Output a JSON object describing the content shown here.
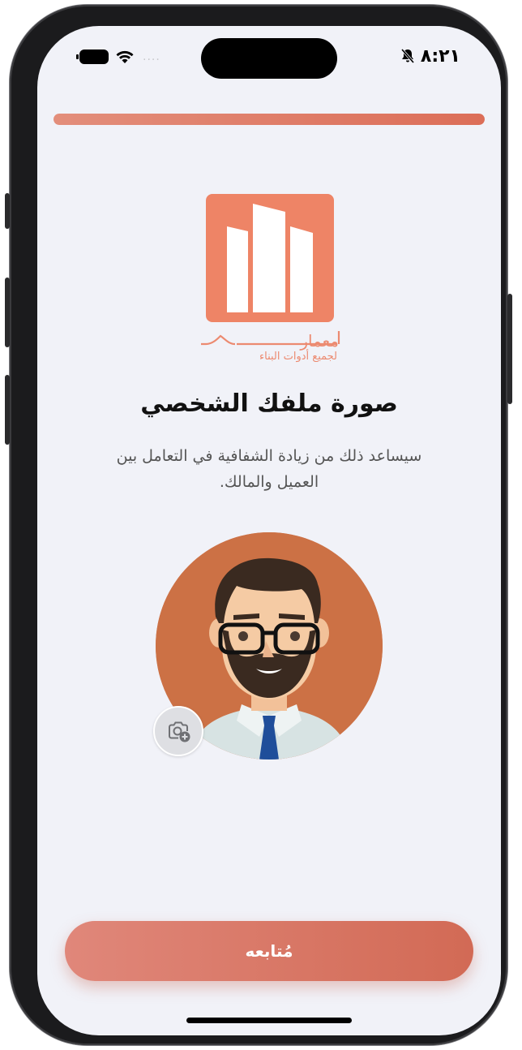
{
  "status_bar": {
    "time": "٨:٢١",
    "signal_dots": "....",
    "icons": [
      "battery-icon",
      "wifi-icon",
      "bell-slash-icon"
    ]
  },
  "onboarding": {
    "progress": 1.0,
    "progress_color": "#dc6e58"
  },
  "brand": {
    "logo_color": "#ee8466",
    "name": "معمار",
    "tagline": "لجميع أدوات البناء"
  },
  "content": {
    "title": "صورة ملفك الشخصي",
    "subtitle": "سيساعد ذلك من زيادة الشفافية في التعامل بين العميل والمالك."
  },
  "avatar": {
    "background_color": "#cc7145",
    "edit_icon": "camera-plus-icon"
  },
  "actions": {
    "continue_label": "مُتابعه",
    "accent_color": "#d26a55"
  }
}
